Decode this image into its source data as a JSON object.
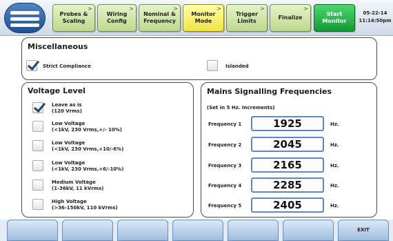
{
  "header": {
    "tabs": [
      {
        "label_line1": "Probes &",
        "label_line2": "Scaling",
        "arrow": ">"
      },
      {
        "label_line1": "Wiring",
        "label_line2": "Config",
        "arrow": ">"
      },
      {
        "label_line1": "Nominal &",
        "label_line2": "Frequency",
        "arrow": ">"
      },
      {
        "label_line1": "Monitor",
        "label_line2": "Mode",
        "arrow": ">"
      },
      {
        "label_line1": "Trigger",
        "label_line2": "Limits",
        "arrow": ">"
      },
      {
        "label_line1": "Finalize",
        "label_line2": "",
        "arrow": ">"
      },
      {
        "label_line1": "Start",
        "label_line2": "Monitor",
        "arrow": ""
      }
    ],
    "active_tab": "Monitor Mode",
    "date": "05-22-14",
    "time": "11:14:50pm",
    "colors": {
      "tab": "#bcd98e",
      "active_tab": "#f1e341",
      "start_tab": "#129a36"
    }
  },
  "miscellaneous": {
    "title": "Miscellaneous",
    "strict_compliance": {
      "label": "Strict Compliance",
      "checked": true
    },
    "islanded": {
      "label": "Islanded",
      "checked": false
    }
  },
  "voltage_level": {
    "title": "Voltage Level",
    "options": [
      {
        "line1": "Leave as is",
        "line2": "(120 Vrms)",
        "checked": true
      },
      {
        "line1": "Low Voltage",
        "line2": "(<1kV, 230 Vrms,+/- 10%)",
        "checked": false
      },
      {
        "line1": "Low Voltage",
        "line2": "(<1kV, 230 Vrms,+10/-6%)",
        "checked": false
      },
      {
        "line1": "Low Voltage",
        "line2": "(<1kV, 230 Vrms,+6/-10%)",
        "checked": false
      },
      {
        "line1": "Medium Voltage",
        "line2": "(1-36kV, 11 kVrms)",
        "checked": false
      },
      {
        "line1": "High Voltage",
        "line2": "(>36-150kV, 110 kVrms)",
        "checked": false
      }
    ]
  },
  "mains_signalling": {
    "title": "Mains Signalling Frequencies",
    "note": "(Set in 5 Hz. Increments)",
    "unit": "Hz.",
    "frequencies": [
      {
        "label": "Frequency 1",
        "value": "1925"
      },
      {
        "label": "Frequency 2",
        "value": "2045"
      },
      {
        "label": "Frequency 3",
        "value": "2165"
      },
      {
        "label": "Frequency 4",
        "value": "2285"
      },
      {
        "label": "Frequency 5",
        "value": "2405"
      }
    ]
  },
  "footer": {
    "buttons": [
      "",
      "",
      "",
      "",
      "",
      "",
      "EXIT"
    ]
  }
}
